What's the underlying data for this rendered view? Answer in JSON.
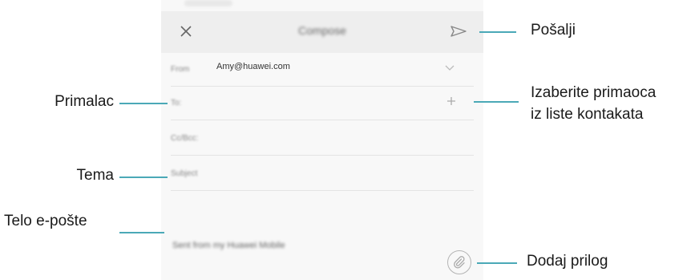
{
  "compose": {
    "title": "Compose",
    "from_label": "From",
    "from_value": "Amy@huawei.com",
    "to_label": "To:",
    "cc_label": "Cc/Bcc:",
    "subject_label": "Subject",
    "body_text": "Sent from my Huawei Mobile"
  },
  "callouts": {
    "send": "Pošalji",
    "recipient": "Primalac",
    "choose_recipient_line1": "Izaberite primaoca",
    "choose_recipient_line2": "iz liste kontakata",
    "subject": "Tema",
    "body": "Telo e-pošte",
    "attach": "Dodaj prilog"
  },
  "colors": {
    "callout_line": "#4ba9b7",
    "toolbar_bg": "#eeeeee",
    "screen_bg": "#f8f8f8"
  },
  "icons": [
    "close-icon",
    "send-icon",
    "chevron-down-icon",
    "plus-icon",
    "paperclip-icon"
  ]
}
